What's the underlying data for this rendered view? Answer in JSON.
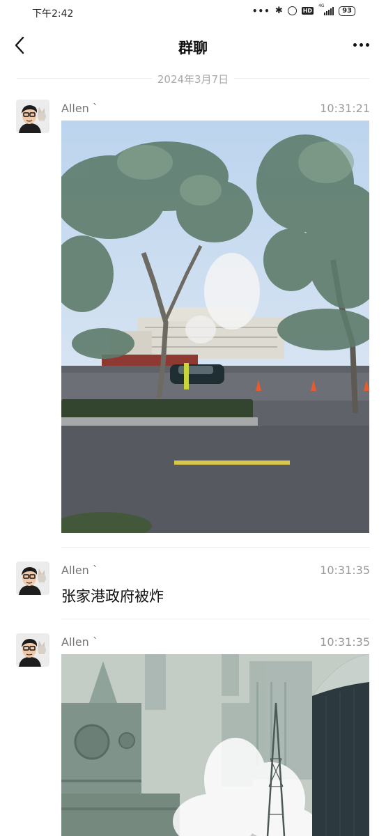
{
  "status_bar": {
    "time": "下午2:42",
    "network": "4G",
    "battery": "93"
  },
  "nav": {
    "title": "群聊"
  },
  "date_separator": "2024年3月7日",
  "messages": [
    {
      "sender": "Allen `",
      "time": "10:31:21",
      "type": "image",
      "image": "street-photo"
    },
    {
      "sender": "Allen `",
      "time": "10:31:35",
      "type": "text",
      "text": "张家港政府被炸"
    },
    {
      "sender": "Allen `",
      "time": "10:31:35",
      "type": "image",
      "image": "city-smoke-photo"
    }
  ],
  "icons": {
    "back": "chevron-left-icon",
    "more": "more-dots-icon",
    "avatar": "cartoon-avatar"
  }
}
